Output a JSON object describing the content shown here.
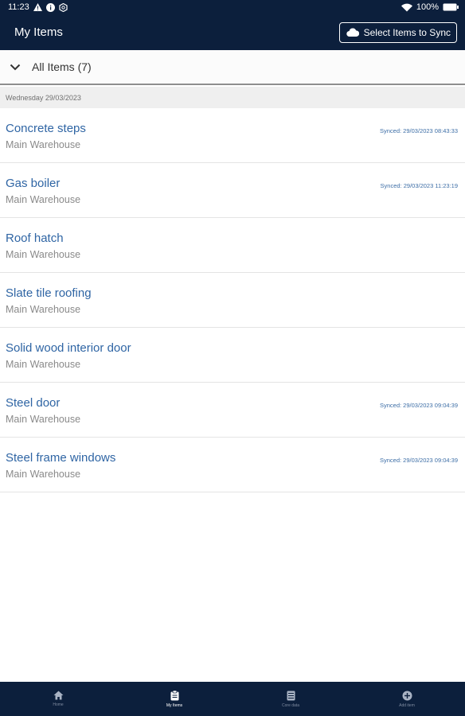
{
  "status_bar": {
    "time": "11:23",
    "battery": "100%"
  },
  "app_bar": {
    "title": "My Items",
    "sync_button_label": "Select Items to Sync"
  },
  "filter": {
    "label": "All Items (7)"
  },
  "date_header": "Wednesday 29/03/2023",
  "items": [
    {
      "name": "Concrete steps",
      "location": "Main Warehouse",
      "synced": "Synced: 29/03/2023 08:43:33"
    },
    {
      "name": "Gas boiler",
      "location": "Main Warehouse",
      "synced": "Synced: 29/03/2023 11:23:19"
    },
    {
      "name": "Roof hatch",
      "location": "Main Warehouse",
      "synced": ""
    },
    {
      "name": "Slate tile roofing",
      "location": "Main Warehouse",
      "synced": ""
    },
    {
      "name": "Solid wood interior door",
      "location": "Main Warehouse",
      "synced": ""
    },
    {
      "name": "Steel door",
      "location": "Main Warehouse",
      "synced": "Synced: 29/03/2023 09:04:39"
    },
    {
      "name": "Steel frame windows",
      "location": "Main Warehouse",
      "synced": "Synced: 29/03/2023 09:04:39"
    }
  ],
  "bottom_nav": [
    {
      "label": "Home",
      "icon": "home-icon"
    },
    {
      "label": "My Items",
      "icon": "clipboard-icon"
    },
    {
      "label": "Core data",
      "icon": "database-icon"
    },
    {
      "label": "Add item",
      "icon": "add-icon"
    }
  ],
  "colors": {
    "navy": "#0c1f3c",
    "link_blue": "#2f65a4",
    "muted_gray": "#8a8a8a"
  }
}
